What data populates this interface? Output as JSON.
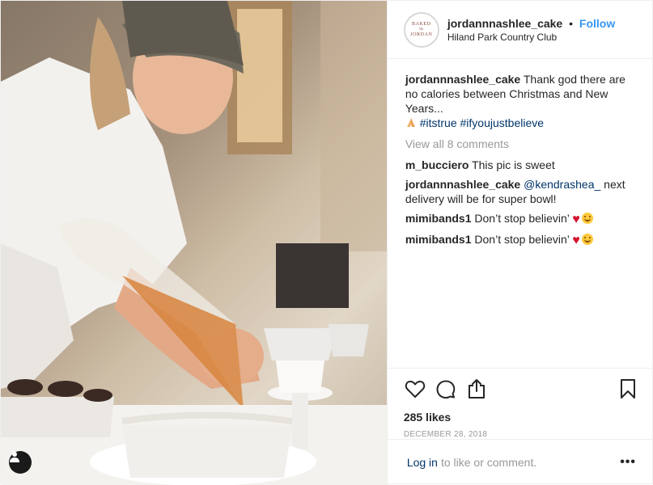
{
  "header": {
    "username": "jordannnashlee_cake",
    "separator": "•",
    "follow_label": "Follow",
    "location": "Hiland Park Country Club",
    "avatar_text": [
      "BAKED",
      "by",
      "JORDAN"
    ]
  },
  "caption": {
    "username": "jordannnashlee_cake",
    "text": "Thank god there are no calories between Christmas and New Years...",
    "emoji": "praying-hands",
    "hashtags": [
      "#itstrue",
      "#ifyoujustbelieve"
    ]
  },
  "view_all_comments": "View all 8 comments",
  "comments": [
    {
      "username": "m_bucciero",
      "text": "This pic is sweet"
    },
    {
      "username": "jordannnashlee_cake",
      "mention": "@kendrashea_",
      "text": "next delivery will be for super bowl!"
    },
    {
      "username": "mimibands1",
      "text": "Don’t stop believin’",
      "emojis": [
        "red-heart",
        "smiling-face"
      ]
    },
    {
      "username": "mimibands1",
      "text": "Don’t stop believin’",
      "emojis": [
        "red-heart",
        "smiling-face"
      ]
    }
  ],
  "actions": {
    "icons": [
      "heart-icon",
      "comment-icon",
      "share-icon",
      "bookmark-icon"
    ]
  },
  "likes": "285 likes",
  "date": "DECEMBER 28, 2018",
  "login_bar": {
    "login_label": "Log in",
    "rest_text": "to like or comment.",
    "more_label": "•••"
  },
  "colors": {
    "accent": "#3897f0",
    "link": "#003569",
    "muted": "#999999",
    "text": "#262626",
    "border": "#efefef"
  }
}
